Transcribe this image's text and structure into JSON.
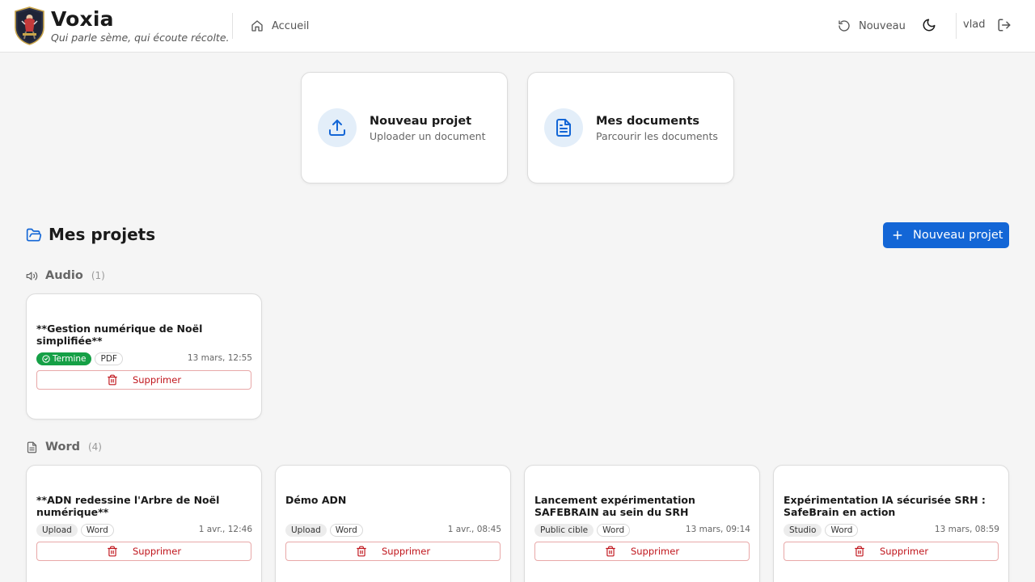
{
  "header": {
    "brand": "Voxia",
    "tagline": "Qui parle sème, qui écoute récolte.",
    "nav_home": "Accueil",
    "nav_new": "Nouveau",
    "username": "vlad"
  },
  "actions": [
    {
      "title": "Nouveau projet",
      "subtitle": "Uploader un document",
      "icon": "upload-icon"
    },
    {
      "title": "Mes documents",
      "subtitle": "Parcourir les documents",
      "icon": "document-icon"
    }
  ],
  "projects": {
    "title": "Mes projets",
    "new_button": "Nouveau projet",
    "sections": [
      {
        "label": "Audio",
        "count": "(1)",
        "icon": "speaker-icon",
        "items": [
          {
            "title": "**Gestion numérique de Noël simplifiée**",
            "status": "Termine",
            "tags": [
              "PDF"
            ],
            "date": "13 mars, 12:55",
            "delete_label": "Supprimer"
          }
        ]
      },
      {
        "label": "Word",
        "count": "(4)",
        "icon": "file-text-icon",
        "items": [
          {
            "title": "**ADN redessine l'Arbre de Noël numérique**",
            "tags": [
              "Upload",
              "Word"
            ],
            "date": "1 avr., 12:46",
            "delete_label": "Supprimer"
          },
          {
            "title": "Démo ADN",
            "tags": [
              "Upload",
              "Word"
            ],
            "date": "1 avr., 08:45",
            "delete_label": "Supprimer"
          },
          {
            "title": "Lancement expérimentation SAFEBRAIN au sein du SRH",
            "tags": [
              "Public cible",
              "Word"
            ],
            "date": "13 mars, 09:14",
            "delete_label": "Supprimer"
          },
          {
            "title": "Expérimentation IA sécurisée SRH : SafeBrain en action",
            "tags": [
              "Studio",
              "Word"
            ],
            "date": "13 mars, 08:59",
            "delete_label": "Supprimer"
          }
        ]
      }
    ]
  },
  "colors": {
    "primary": "#1366d6",
    "success": "#15a046",
    "danger": "#c0151c",
    "background": "#f5f5f5"
  }
}
